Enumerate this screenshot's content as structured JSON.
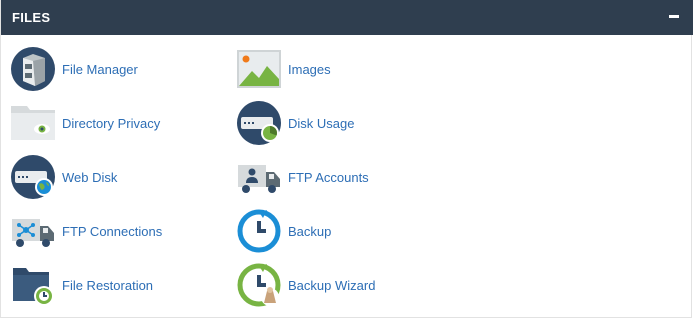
{
  "section": {
    "title": "FILES",
    "collapse_label": "−"
  },
  "items": [
    {
      "id": "file-manager",
      "label": "File Manager",
      "icon": "file-cabinet-icon"
    },
    {
      "id": "images",
      "label": "Images",
      "icon": "image-icon"
    },
    {
      "id": "directory-privacy",
      "label": "Directory Privacy",
      "icon": "folder-eye-icon"
    },
    {
      "id": "disk-usage",
      "label": "Disk Usage",
      "icon": "disk-pie-icon"
    },
    {
      "id": "web-disk",
      "label": "Web Disk",
      "icon": "drive-globe-icon"
    },
    {
      "id": "ftp-accounts",
      "label": "FTP Accounts",
      "icon": "truck-user-icon"
    },
    {
      "id": "ftp-connections",
      "label": "FTP Connections",
      "icon": "truck-network-icon"
    },
    {
      "id": "backup",
      "label": "Backup",
      "icon": "backup-clock-icon"
    },
    {
      "id": "file-restoration",
      "label": "File Restoration",
      "icon": "folder-restore-icon"
    },
    {
      "id": "backup-wizard",
      "label": "Backup Wizard",
      "icon": "backup-wizard-icon"
    }
  ],
  "colors": {
    "header_bg": "#2f3e4f",
    "link": "#2d6eb5",
    "icon_navy": "#2f4a6a",
    "icon_blue": "#1b8ed6",
    "icon_green": "#78b443",
    "icon_gray": "#cfd4d6"
  }
}
